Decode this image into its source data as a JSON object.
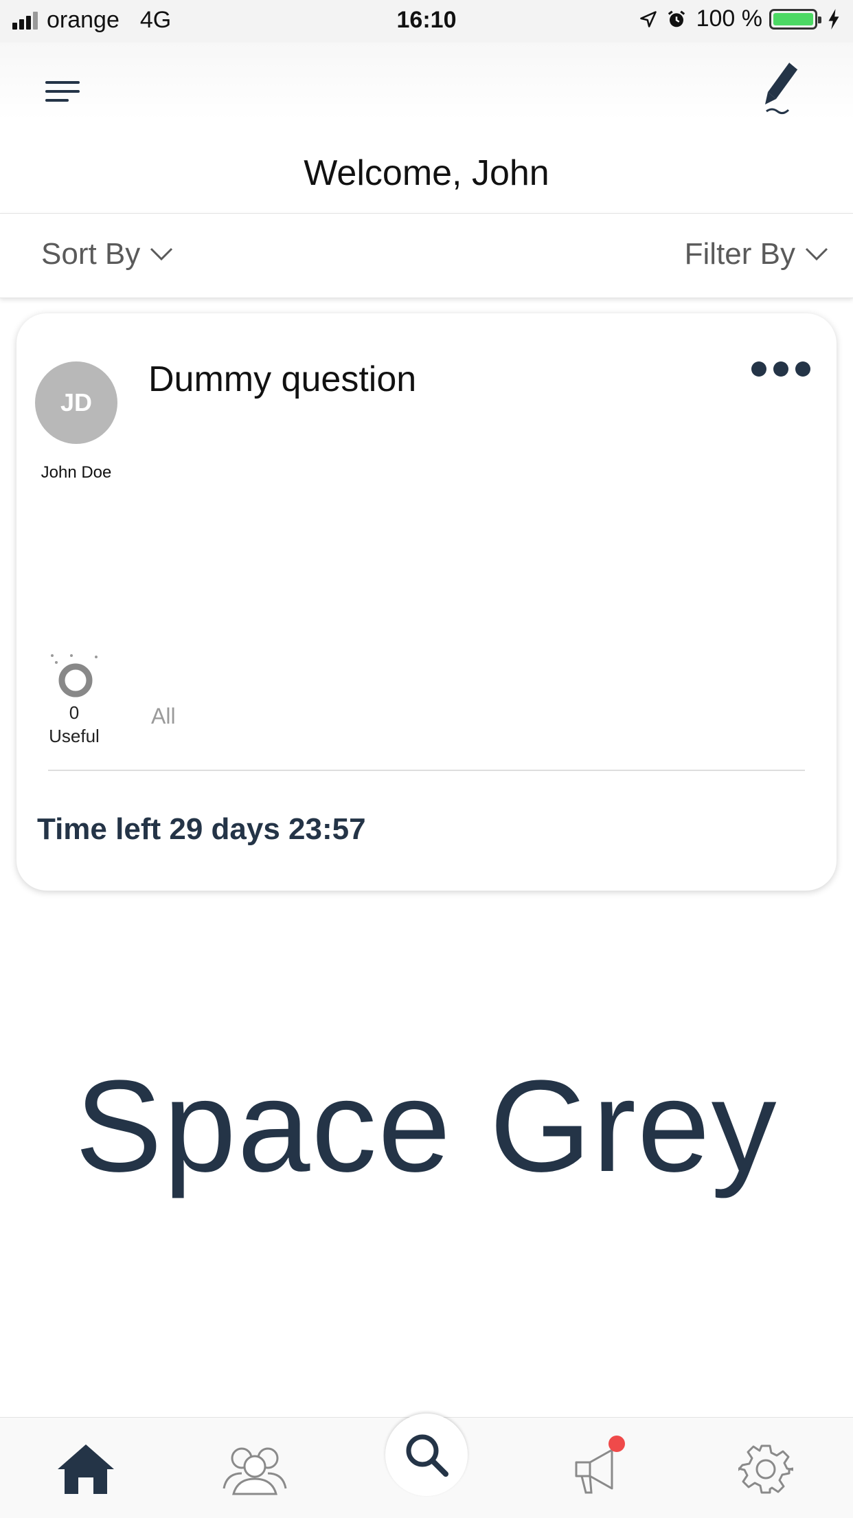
{
  "status_bar": {
    "carrier": "orange",
    "network": "4G",
    "time": "16:10",
    "battery_percent": "100 %"
  },
  "header": {
    "welcome": "Welcome, John"
  },
  "toolbar": {
    "sort_label": "Sort By",
    "filter_label": "Filter By"
  },
  "card": {
    "avatar_initials": "JD",
    "author_name": "John Doe",
    "question_title": "Dummy question",
    "useful_count": "0",
    "useful_label": "Useful",
    "all_label": "All",
    "time_left": "Time left 29 days 23:57"
  },
  "watermark": "Space Grey",
  "tabbar": {
    "items": [
      {
        "icon": "home-icon",
        "active": true
      },
      {
        "icon": "users-icon",
        "active": false
      },
      {
        "icon": "search-icon",
        "active": false
      },
      {
        "icon": "megaphone-icon",
        "active": false,
        "badge": true
      },
      {
        "icon": "settings-gear-icon",
        "active": false
      }
    ]
  },
  "colors": {
    "primary": "#243447",
    "badge": "#ef4a4a",
    "battery": "#4cd964",
    "muted": "#9a9a9a"
  }
}
